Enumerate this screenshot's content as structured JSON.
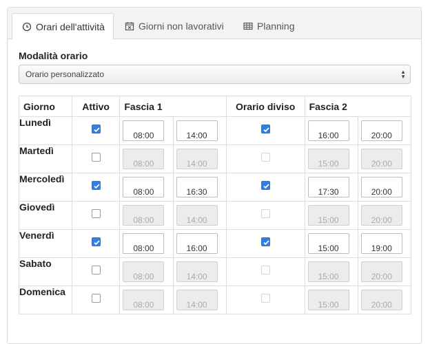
{
  "tabs": [
    {
      "label": "Orari dell'attività",
      "icon": "clock-icon"
    },
    {
      "label": "Giorni non lavorativi",
      "icon": "calendar-x-icon"
    },
    {
      "label": "Planning",
      "icon": "table-icon"
    }
  ],
  "mode": {
    "label": "Modalità orario",
    "selected": "Orario personalizzato"
  },
  "table": {
    "headers": {
      "day": "Giorno",
      "active": "Attivo",
      "slot1": "Fascia 1",
      "split": "Orario diviso",
      "slot2": "Fascia 2"
    },
    "rows": [
      {
        "day": "Lunedì",
        "active": true,
        "s1_from": "08:00",
        "s1_to": "14:00",
        "split": true,
        "s2_from": "16:00",
        "s2_to": "20:00"
      },
      {
        "day": "Martedì",
        "active": false,
        "s1_from": "08:00",
        "s1_to": "14:00",
        "split": false,
        "s2_from": "15:00",
        "s2_to": "20:00"
      },
      {
        "day": "Mercoledì",
        "active": true,
        "s1_from": "08:00",
        "s1_to": "16:30",
        "split": true,
        "s2_from": "17:30",
        "s2_to": "20:00"
      },
      {
        "day": "Giovedì",
        "active": false,
        "s1_from": "08:00",
        "s1_to": "14:00",
        "split": false,
        "s2_from": "15:00",
        "s2_to": "20:00"
      },
      {
        "day": "Venerdì",
        "active": true,
        "s1_from": "08:00",
        "s1_to": "16:00",
        "split": true,
        "s2_from": "15:00",
        "s2_to": "19:00"
      },
      {
        "day": "Sabato",
        "active": false,
        "s1_from": "08:00",
        "s1_to": "14:00",
        "split": false,
        "s2_from": "15:00",
        "s2_to": "20:00"
      },
      {
        "day": "Domenica",
        "active": false,
        "s1_from": "08:00",
        "s1_to": "14:00",
        "split": false,
        "s2_from": "15:00",
        "s2_to": "20:00"
      }
    ]
  },
  "colors": {
    "checkbox_on": "#2f7fe8",
    "disabled_input_bg": "#ececec"
  }
}
